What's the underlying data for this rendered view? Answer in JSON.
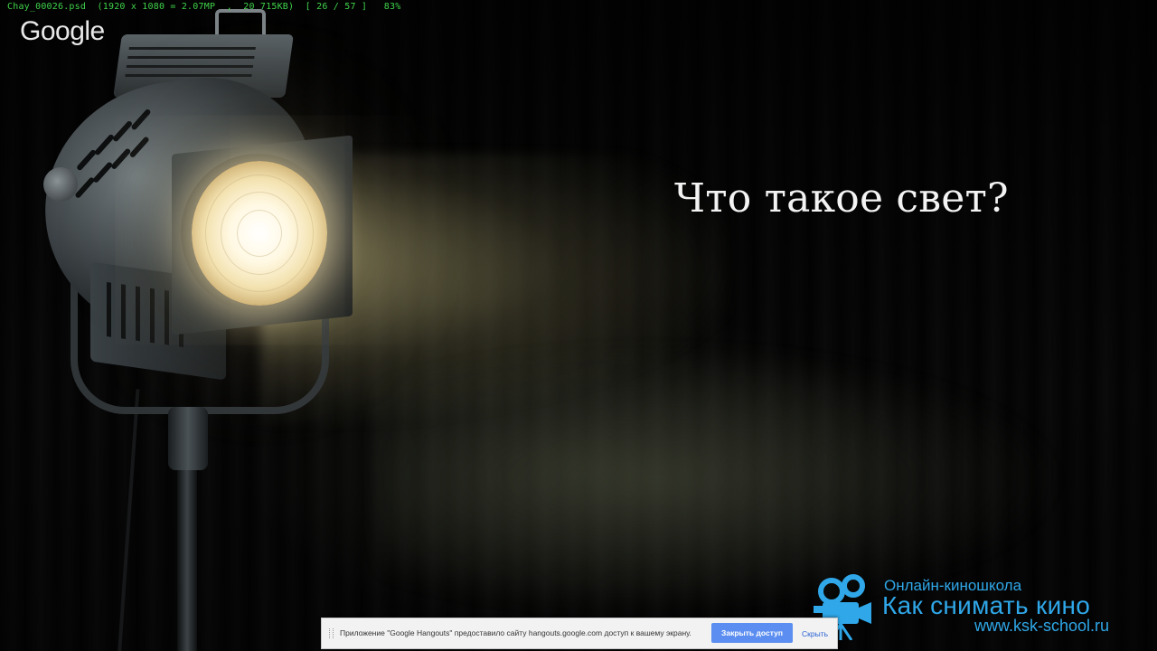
{
  "overlay_info": "Chay_00026.psd  (1920 x 1080 = 2.07MP  ,  20 715KB)  [ 26 / 57 ]   83%",
  "brand": "Google",
  "slide": {
    "title": "Что такое свет?"
  },
  "school_logo": {
    "line1": "Онлайн-киношкола",
    "line2": "Как снимать кино",
    "line3": "www.ksk-school.ru",
    "icon": "film-camera-icon",
    "color": "#2fa7e8"
  },
  "share_bar": {
    "message": "Приложение \"Google Hangouts\" предоставило сайту hangouts.google.com доступ к вашему экрану.",
    "stop_label": "Закрыть доступ",
    "hide_label": "Скрыть",
    "accent": "#5b8ef0"
  }
}
